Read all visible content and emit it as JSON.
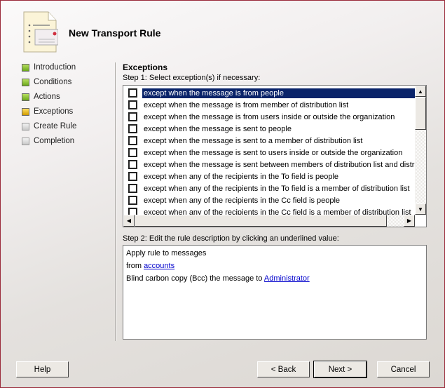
{
  "header": {
    "title": "New Transport Rule",
    "icon": "document-list-icon"
  },
  "nav": [
    {
      "label": "Introduction",
      "state": "completed",
      "color": "#8cc63f"
    },
    {
      "label": "Conditions",
      "state": "completed",
      "color": "#8cc63f"
    },
    {
      "label": "Actions",
      "state": "completed",
      "color": "#8cc63f"
    },
    {
      "label": "Exceptions",
      "state": "current",
      "color": "#e8b400"
    },
    {
      "label": "Create Rule",
      "state": "pending",
      "color": "#d8d8d8"
    },
    {
      "label": "Completion",
      "state": "pending",
      "color": "#d8d8d8"
    }
  ],
  "main": {
    "heading": "Exceptions",
    "step1": "Step 1: Select exception(s) if necessary:",
    "exceptions": [
      {
        "label": "except when the message is from people",
        "checked": false,
        "selected": true
      },
      {
        "label": "except when the message is from member of distribution list",
        "checked": false
      },
      {
        "label": "except when the message is from users inside or outside the organization",
        "checked": false
      },
      {
        "label": "except when the message is sent to people",
        "checked": false
      },
      {
        "label": "except when the message is sent to a member of distribution list",
        "checked": false
      },
      {
        "label": "except when the message is sent to users inside or outside the organization",
        "checked": false
      },
      {
        "label": "except when the message is sent between members of distribution list and distributi",
        "checked": false
      },
      {
        "label": "except when any of the recipients in the To field is people",
        "checked": false
      },
      {
        "label": "except when any of the recipients in the To field is a member of distribution list",
        "checked": false
      },
      {
        "label": "except when any of the recipients in the Cc field is people",
        "checked": false
      },
      {
        "label": "except when any of the recipients in the Cc field is a member of distribution list",
        "checked": false
      }
    ],
    "step2": "Step 2: Edit the rule description by clicking an underlined value:",
    "description": {
      "line1": "Apply rule to messages",
      "line2_prefix": "from ",
      "line2_link": "accounts",
      "line3_prefix": "Blind carbon copy (Bcc) the message to ",
      "line3_link": "Administrator"
    }
  },
  "buttons": {
    "help": "Help",
    "back": "< Back",
    "next": "Next >",
    "cancel": "Cancel"
  },
  "accent": "#0a246a"
}
